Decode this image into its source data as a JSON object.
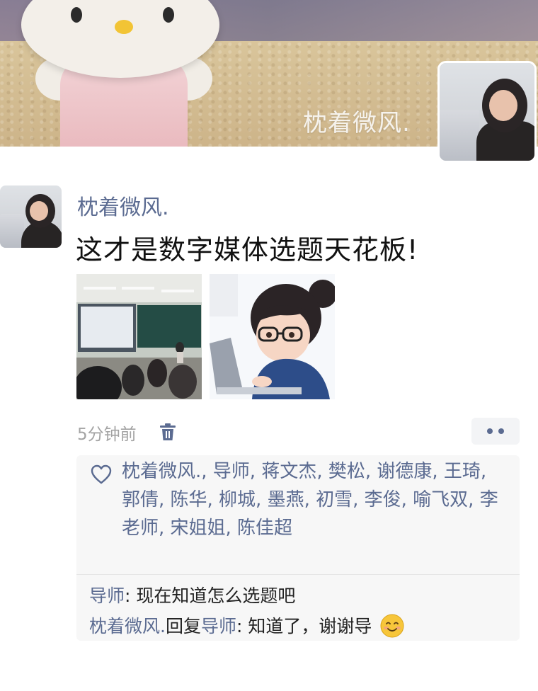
{
  "cover": {
    "display_name": "枕着微风."
  },
  "post": {
    "username": "枕着微风.",
    "text": "这才是数字媒体选题天花板!",
    "time": "5分钟前"
  },
  "likes": {
    "names": "枕着微风., 导师, 蒋文杰, 樊松, 谢德康, 王琦, 郭倩, 陈华, 柳城, 墨燕, 初雪, 李俊, 喻飞双, 李老师, 宋姐姐, 陈佳超"
  },
  "comments": [
    {
      "author": "导师",
      "reply_to": "",
      "text": ": 现在知道怎么选题吧"
    },
    {
      "author": "枕着微风.",
      "reply_word": "回复",
      "reply_to": "导师",
      "text": ": 知道了，谢谢导"
    }
  ],
  "icons": {
    "trash": "trash-icon",
    "heart": "heart-icon",
    "more": "more-dots-icon",
    "emoji": "smile-emoji-icon"
  },
  "colors": {
    "name_link": "#5b6b91",
    "panel_bg": "#f7f7f7",
    "time_gray": "#a3a3a3"
  }
}
